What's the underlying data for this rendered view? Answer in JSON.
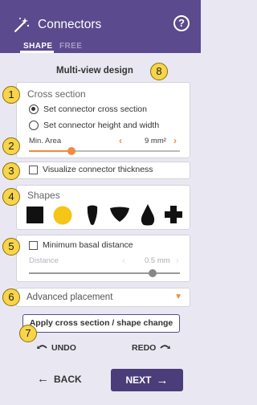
{
  "header": {
    "title": "Connectors",
    "help_icon": "question-circle-icon",
    "title_icon": "magic-wand-icon",
    "tabs": [
      {
        "label": "SHAPE",
        "active": true
      },
      {
        "label": "FREE",
        "active": false
      }
    ]
  },
  "main": {
    "design_title": "Multi-view design",
    "badges": [
      "1",
      "2",
      "3",
      "4",
      "5",
      "6",
      "7",
      "8"
    ]
  },
  "cross_section": {
    "heading": "Cross section",
    "options": [
      {
        "label": "Set connector cross section",
        "selected": true
      },
      {
        "label": "Set connector height and width",
        "selected": false
      }
    ],
    "min_area_label": "Min. Area",
    "min_area_value": "9 mm²",
    "min_area_fraction": 0.28
  },
  "thickness": {
    "label": "Visualize connector thickness",
    "checked": false
  },
  "shapes": {
    "heading": "Shapes",
    "items": [
      "square",
      "circle",
      "teardrop",
      "shield",
      "pointed-drop",
      "cross"
    ],
    "selected": "circle",
    "selected_color": "#f5c518"
  },
  "basal": {
    "label": "Minimum basal distance",
    "checked": false,
    "distance_label": "Distance",
    "distance_value": "0.5 mm",
    "distance_fraction": 0.82
  },
  "advanced": {
    "label": "Advanced placement"
  },
  "actions": {
    "apply_label": "Apply cross section / shape change",
    "undo_label": "UNDO",
    "redo_label": "REDO",
    "back_label": "BACK",
    "next_label": "NEXT"
  },
  "colors": {
    "header_bg": "#5b4a8e",
    "accent": "#f08a3e",
    "badge": "#f7d44a",
    "next_bg": "#4a3d7a"
  }
}
